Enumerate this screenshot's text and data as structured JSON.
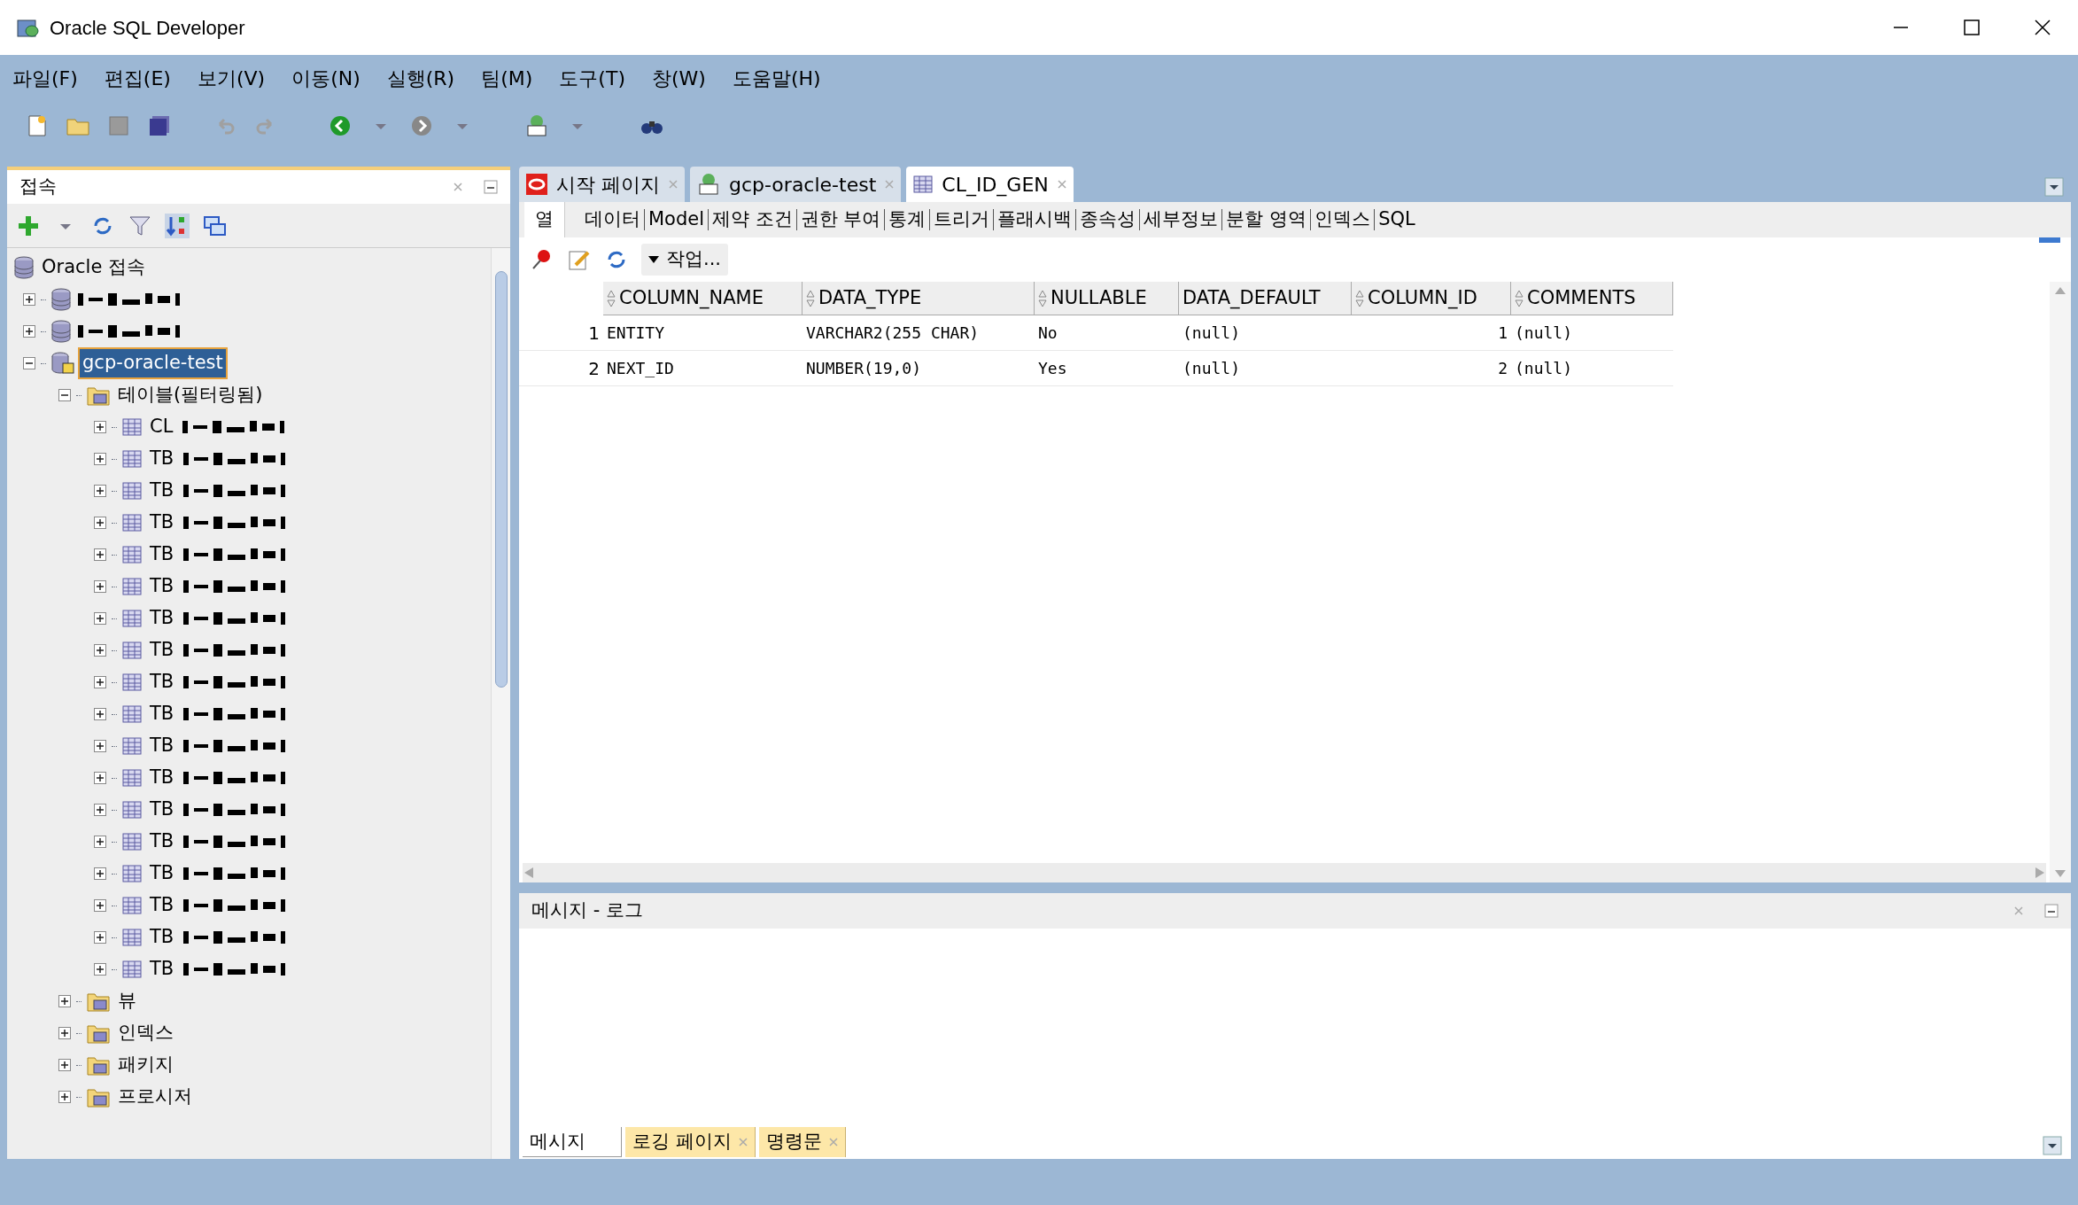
{
  "window": {
    "title": "Oracle SQL Developer"
  },
  "menu": [
    "파일(F)",
    "편집(E)",
    "보기(V)",
    "이동(N)",
    "실행(R)",
    "팀(M)",
    "도구(T)",
    "창(W)",
    "도움말(H)"
  ],
  "connections_panel": {
    "title": "접속",
    "tree": [
      {
        "label": "Oracle 접속",
        "kind": "database",
        "selected": false,
        "children": [
          {
            "kind": "database",
            "redacted": true,
            "expanded": false,
            "selected": false
          },
          {
            "kind": "database",
            "redacted": true,
            "expanded": false,
            "selected": false
          },
          {
            "label": "gcp-oracle-test",
            "kind": "connection",
            "expanded": true,
            "selected": true,
            "children": [
              {
                "label": "테이블(필터링됨)",
                "kind": "folder",
                "expanded": true,
                "selected": false,
                "children": [
                  {
                    "label": "CL",
                    "kind": "table",
                    "redacted": true,
                    "expanded": false,
                    "selected": false
                  },
                  {
                    "label": "TB",
                    "kind": "table",
                    "redacted": true,
                    "expanded": false,
                    "selected": false
                  },
                  {
                    "label": "TB",
                    "kind": "table",
                    "redacted": true,
                    "expanded": false,
                    "selected": false
                  },
                  {
                    "label": "TB",
                    "kind": "table",
                    "redacted": true,
                    "expanded": false,
                    "selected": false
                  },
                  {
                    "label": "TB",
                    "kind": "table",
                    "redacted": true,
                    "expanded": false,
                    "selected": false
                  },
                  {
                    "label": "TB",
                    "kind": "table",
                    "redacted": true,
                    "expanded": false,
                    "selected": false
                  },
                  {
                    "label": "TB",
                    "kind": "table",
                    "redacted": true,
                    "expanded": false,
                    "selected": false
                  },
                  {
                    "label": "TB",
                    "kind": "table",
                    "redacted": true,
                    "expanded": false,
                    "selected": false
                  },
                  {
                    "label": "TB",
                    "kind": "table",
                    "redacted": true,
                    "expanded": false,
                    "selected": false
                  },
                  {
                    "label": "TB",
                    "kind": "table",
                    "redacted": true,
                    "expanded": false,
                    "selected": false
                  },
                  {
                    "label": "TB",
                    "kind": "table",
                    "redacted": true,
                    "expanded": false,
                    "selected": false
                  },
                  {
                    "label": "TB",
                    "kind": "table",
                    "redacted": true,
                    "expanded": false,
                    "selected": false
                  },
                  {
                    "label": "TB",
                    "kind": "table",
                    "redacted": true,
                    "expanded": false,
                    "selected": false
                  },
                  {
                    "label": "TB",
                    "kind": "table",
                    "redacted": true,
                    "expanded": false,
                    "selected": false
                  },
                  {
                    "label": "TB",
                    "kind": "table",
                    "redacted": true,
                    "expanded": false,
                    "selected": false
                  },
                  {
                    "label": "TB",
                    "kind": "table",
                    "redacted": true,
                    "expanded": false,
                    "selected": false
                  },
                  {
                    "label": "TB",
                    "kind": "table",
                    "redacted": true,
                    "expanded": false,
                    "selected": false
                  },
                  {
                    "label": "TB",
                    "kind": "table",
                    "redacted": true,
                    "expanded": false,
                    "selected": false
                  }
                ]
              },
              {
                "label": "뷰",
                "kind": "folder",
                "expanded": false,
                "selected": false
              },
              {
                "label": "인덱스",
                "kind": "folder",
                "expanded": false,
                "selected": false
              },
              {
                "label": "패키지",
                "kind": "folder",
                "expanded": false,
                "selected": false
              },
              {
                "label": "프로시저",
                "kind": "folder",
                "expanded": false,
                "selected": false
              }
            ]
          }
        ]
      }
    ]
  },
  "editor_tabs": [
    {
      "label": "시작 페이지",
      "kind": "start",
      "selected": false
    },
    {
      "label": "gcp-oracle-test",
      "kind": "sql",
      "selected": false
    },
    {
      "label": "CL_ID_GEN",
      "kind": "table",
      "selected": true
    }
  ],
  "sub_tabs": [
    {
      "label": "열",
      "selected": true
    },
    {
      "label": "데이터",
      "selected": false
    },
    {
      "label": "Model",
      "selected": false
    },
    {
      "label": "제약 조건",
      "selected": false
    },
    {
      "label": "권한 부여",
      "selected": false
    },
    {
      "label": "통계",
      "selected": false
    },
    {
      "label": "트리거",
      "selected": false
    },
    {
      "label": "플래시백",
      "selected": false
    },
    {
      "label": "종속성",
      "selected": false
    },
    {
      "label": "세부정보",
      "selected": false
    },
    {
      "label": "분할 영역",
      "selected": false
    },
    {
      "label": "인덱스",
      "selected": false
    },
    {
      "label": "SQL",
      "selected": false
    }
  ],
  "actions_button": "작업...",
  "table": {
    "columns": [
      {
        "kind": "row_number"
      },
      {
        "label": "COLUMN_NAME",
        "sortable": true
      },
      {
        "label": "DATA_TYPE",
        "sortable": true
      },
      {
        "label": "NULLABLE",
        "sortable": true
      },
      {
        "label": "DATA_DEFAULT",
        "sortable": false
      },
      {
        "label": "COLUMN_ID",
        "sortable": true
      },
      {
        "label": "COMMENTS",
        "sortable": true
      }
    ],
    "rows": [
      [
        "1",
        "ENTITY",
        "VARCHAR2(255 CHAR)",
        "No",
        "(null)",
        "1",
        "(null)"
      ],
      [
        "2",
        "NEXT_ID",
        "NUMBER(19,0)",
        "Yes",
        "(null)",
        "2",
        "(null)"
      ]
    ]
  },
  "message_panel": {
    "title": "메시지 - 로그",
    "tabs": [
      {
        "label": "메시지",
        "selected": true
      },
      {
        "label": "로깅 페이지",
        "selected": false
      },
      {
        "label": "명령문",
        "selected": false
      }
    ]
  }
}
